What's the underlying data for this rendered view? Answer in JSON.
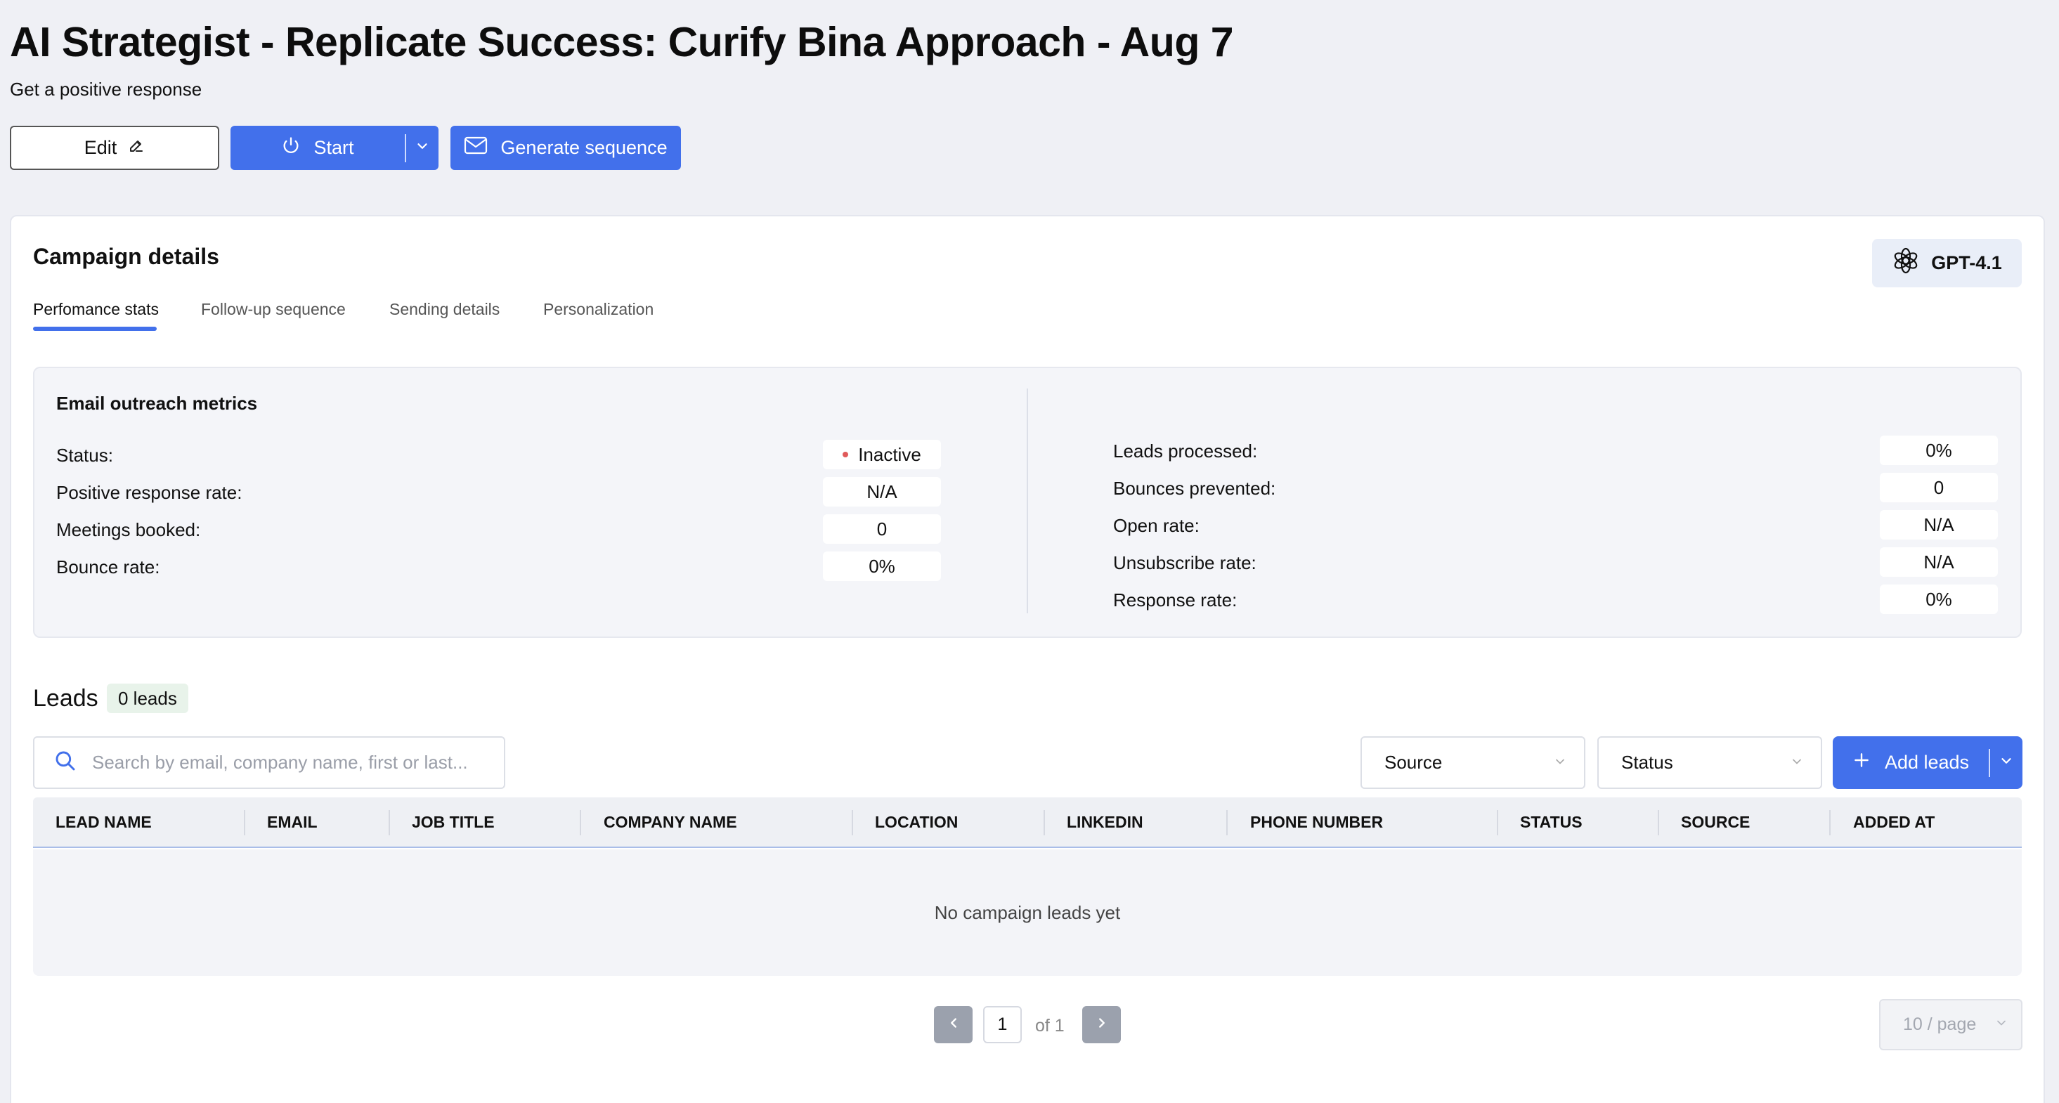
{
  "header": {
    "title": "AI Strategist - Replicate Success: Curify Bina Approach - Aug 7",
    "subtitle": "Get a positive response"
  },
  "toolbar": {
    "edit_label": "Edit",
    "start_label": "Start",
    "generate_label": "Generate sequence"
  },
  "campaign": {
    "title": "Campaign details",
    "model_label": "GPT-4.1",
    "tabs": [
      {
        "label": "Perfomance stats",
        "active": true
      },
      {
        "label": "Follow-up sequence",
        "active": false
      },
      {
        "label": "Sending details",
        "active": false
      },
      {
        "label": "Personalization",
        "active": false
      }
    ]
  },
  "metrics": {
    "title": "Email outreach metrics",
    "left": [
      {
        "label": "Status:",
        "value": "Inactive"
      },
      {
        "label": "Positive response rate:",
        "value": "N/A"
      },
      {
        "label": "Meetings booked:",
        "value": "0"
      },
      {
        "label": "Bounce rate:",
        "value": "0%"
      }
    ],
    "right": [
      {
        "label": "Leads processed:",
        "value": "0%"
      },
      {
        "label": "Bounces prevented:",
        "value": "0"
      },
      {
        "label": "Open rate:",
        "value": "N/A"
      },
      {
        "label": "Unsubscribe rate:",
        "value": "N/A"
      },
      {
        "label": "Response rate:",
        "value": "0%"
      }
    ],
    "status_color": "#e05a5a"
  },
  "leads": {
    "title": "Leads",
    "count_label": "0 leads",
    "search_placeholder": "Search by email, company name, first or last...",
    "source_label": "Source",
    "status_label": "Status",
    "add_label": "Add leads",
    "columns": [
      "LEAD NAME",
      "EMAIL",
      "JOB TITLE",
      "COMPANY NAME",
      "LOCATION",
      "LINKEDIN",
      "PHONE NUMBER",
      "STATUS",
      "SOURCE",
      "ADDED AT"
    ],
    "empty_text": "No campaign leads yet"
  },
  "pagination": {
    "current": "1",
    "of_label": "of 1",
    "page_size": "10 / page"
  },
  "colors": {
    "accent": "#4270eb",
    "background": "#eff0f5"
  }
}
